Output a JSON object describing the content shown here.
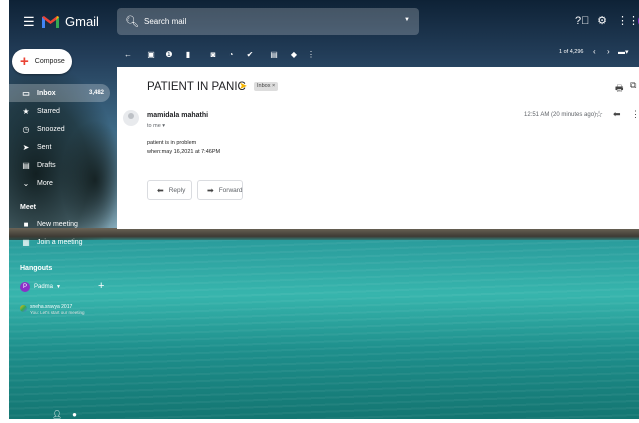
{
  "app": {
    "name": "Gmail",
    "search_placeholder": "Search mail"
  },
  "header_icons": [
    "help-icon",
    "settings-icon",
    "apps-icon"
  ],
  "account_initial": "P",
  "compose_label": "Compose",
  "nav": [
    {
      "label": "Inbox",
      "count": "3,482",
      "icon": "inbox-icon",
      "active": true
    },
    {
      "label": "Starred",
      "count": "",
      "icon": "star-icon"
    },
    {
      "label": "Snoozed",
      "count": "",
      "icon": "clock-icon"
    },
    {
      "label": "Sent",
      "count": "",
      "icon": "send-icon"
    },
    {
      "label": "Drafts",
      "count": "",
      "icon": "draft-icon"
    },
    {
      "label": "More",
      "count": "",
      "icon": "chevron-down-icon"
    }
  ],
  "meet": {
    "title": "Meet",
    "items": [
      "New meeting",
      "Join a meeting"
    ]
  },
  "hangouts": {
    "title": "Hangouts",
    "user": "Padma",
    "contact_line1": "sneha.sravya 2017",
    "contact_line2": "You: Let's start our meeting"
  },
  "toolbar": {
    "pager": "1 of 4,296"
  },
  "email": {
    "subject": "PATIENT IN PANIC",
    "label_chip": "Inbox ×",
    "sender": "mamidala mahathi",
    "to": "to me ▾",
    "timestamp": "12:51 AM (20 minutes ago)",
    "body": [
      "patient is in problem",
      "when:may 16,2021 at 7:46PM"
    ],
    "reply_label": "Reply",
    "forward_label": "Forward"
  },
  "colors": {
    "accent_red": "#ea4335",
    "avatar_purple": "#8b2fc9",
    "important_marker": "#f4b400"
  }
}
